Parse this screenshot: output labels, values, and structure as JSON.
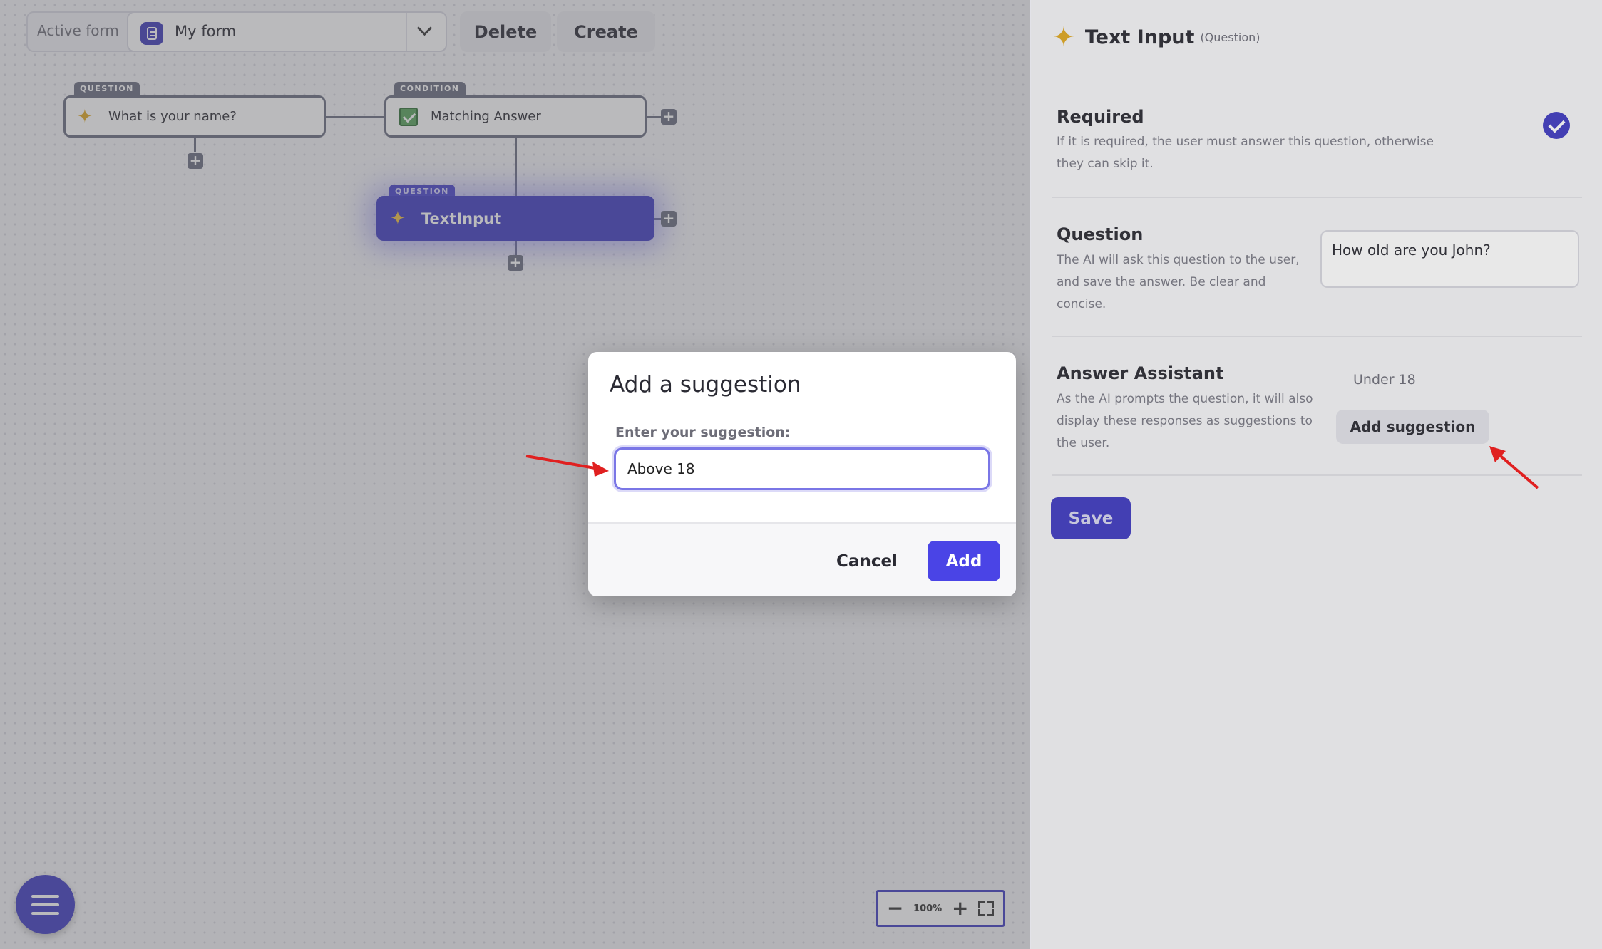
{
  "toolbar": {
    "active_label": "Active form",
    "form_name": "My form",
    "delete_label": "Delete",
    "create_label": "Create"
  },
  "nodes": {
    "question1": {
      "tag": "QUESTION",
      "label": "What is your name?"
    },
    "condition": {
      "tag": "CONDITION",
      "label": "Matching Answer"
    },
    "question2": {
      "tag": "QUESTION",
      "label": "TextInput"
    }
  },
  "zoom": {
    "level": "100%"
  },
  "modal": {
    "title": "Add a suggestion",
    "input_label": "Enter your suggestion:",
    "input_value": "Above 18",
    "cancel_label": "Cancel",
    "add_label": "Add"
  },
  "panel": {
    "title": "Text Input",
    "subtitle": "(Question)",
    "required": {
      "title": "Required",
      "desc_line1": "If it is required, the user must answer this question, otherwise",
      "desc_line2": "they can skip it."
    },
    "question": {
      "title": "Question",
      "desc_line1": "The AI will ask this question to the user,",
      "desc_line2": "and save the answer. Be clear and",
      "desc_line3": "concise.",
      "value": "How old are you John?"
    },
    "assistant": {
      "title": "Answer Assistant",
      "desc_line1": "As the AI prompts the question, it will also",
      "desc_line2": "display these responses as suggestions to",
      "desc_line3": "the user.",
      "suggestions": [
        "Under 18"
      ],
      "add_button": "Add suggestion"
    },
    "save_label": "Save"
  },
  "colors": {
    "accent": "#3f3bc2",
    "add_button": "#4a44e6",
    "annotation_arrow": "#e02020"
  }
}
